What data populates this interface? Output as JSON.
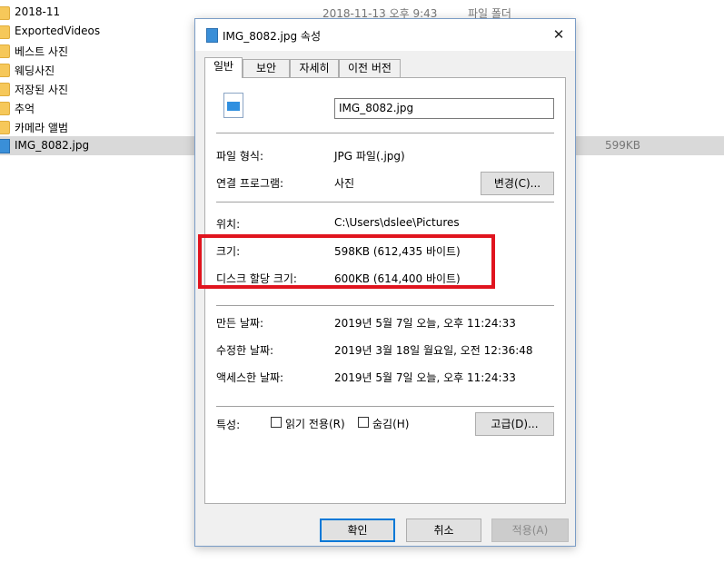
{
  "explorer": {
    "rows": [
      {
        "name": "2018-11",
        "date": "2018-11-13 오후 9:43",
        "type": "파일 폴더",
        "size": "",
        "icon": "folder-icon",
        "selected": false
      },
      {
        "name": "ExportedVideos",
        "date": "",
        "type": "",
        "size": "",
        "icon": "folder-icon",
        "selected": false
      },
      {
        "name": "베스트 사진",
        "date": "",
        "type": "",
        "size": "",
        "icon": "folder-icon",
        "selected": false
      },
      {
        "name": "웨딩사진",
        "date": "",
        "type": "",
        "size": "",
        "icon": "folder-icon",
        "selected": false
      },
      {
        "name": "저장된 사진",
        "date": "",
        "type": "",
        "size": "",
        "icon": "folder-icon",
        "selected": false
      },
      {
        "name": "추억",
        "date": "",
        "type": "",
        "size": "",
        "icon": "folder-icon",
        "selected": false
      },
      {
        "name": "카메라 앨범",
        "date": "",
        "type": "",
        "size": "",
        "icon": "folder-icon",
        "selected": false
      },
      {
        "name": "IMG_8082.jpg",
        "date": "",
        "type": "",
        "size": "599KB",
        "icon": "image-file-icon",
        "selected": true
      }
    ]
  },
  "dialog": {
    "title": "IMG_8082.jpg 속성",
    "close_label": "✕",
    "tabs": [
      "일반",
      "보안",
      "자세히",
      "이전 버전"
    ],
    "filename": "IMG_8082.jpg",
    "file_type_label": "파일 형식:",
    "file_type_value": "JPG 파일(.jpg)",
    "opens_with_label": "연결 프로그램:",
    "opens_with_value": "사진",
    "change_button": "변경(C)...",
    "location_label": "위치:",
    "location_value": "C:\\Users\\dslee\\Pictures",
    "size_label": "크기:",
    "size_value": "598KB (612,435 바이트)",
    "size_on_disk_label": "디스크 할당 크기:",
    "size_on_disk_value": "600KB (614,400 바이트)",
    "created_label": "만든 날짜:",
    "created_value": "2019년 5월 7일 오늘, 오후 11:24:33",
    "modified_label": "수정한 날짜:",
    "modified_value": "2019년 3월 18일 월요일, 오전 12:36:48",
    "accessed_label": "액세스한 날짜:",
    "accessed_value": "2019년 5월 7일 오늘, 오후 11:24:33",
    "attributes_label": "특성:",
    "readonly_label": "읽기 전용(R)",
    "hidden_label": "숨김(H)",
    "advanced_button": "고급(D)...",
    "ok_button": "확인",
    "cancel_button": "취소",
    "apply_button": "적용(A)"
  },
  "colors": {
    "highlight": "#e0141e",
    "accent": "#0078d7",
    "folder": "#f6c85a"
  }
}
